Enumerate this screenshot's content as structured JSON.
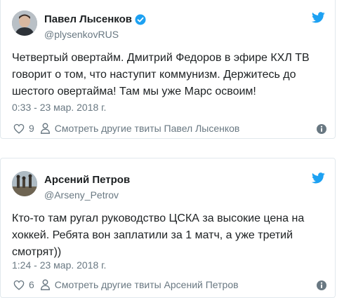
{
  "tweets": [
    {
      "name": "Павел Лысенков",
      "handle": "@plysenkovRUS",
      "verified": true,
      "text": "Четвертый овертайм. Дмитрий Федоров в эфире КХЛ ТВ говорит о том, что наступит коммунизм. Держитесь до шестого овертайма! Там мы уже Марс освоим!",
      "timestamp": "0:33 - 23 мар. 2018 г.",
      "likes": "9",
      "more_link": "Смотреть другие твиты Павел Лысенков"
    },
    {
      "name": "Арсений Петров",
      "handle": "@Arseny_Petrov",
      "verified": false,
      "text": "Кто-то там ругал руководство ЦСКА за высокие цена на хоккей. Ребята вон заплатили за 1 матч, а уже третий смотрят))",
      "timestamp": "1:24 - 23 мар. 2018 г.",
      "likes": "6",
      "more_link": "Смотреть другие твиты Арсений Петров"
    }
  ],
  "colors": {
    "twitter_blue": "#1da1f2",
    "muted_text": "#697882",
    "border": "#e1e8ed"
  }
}
